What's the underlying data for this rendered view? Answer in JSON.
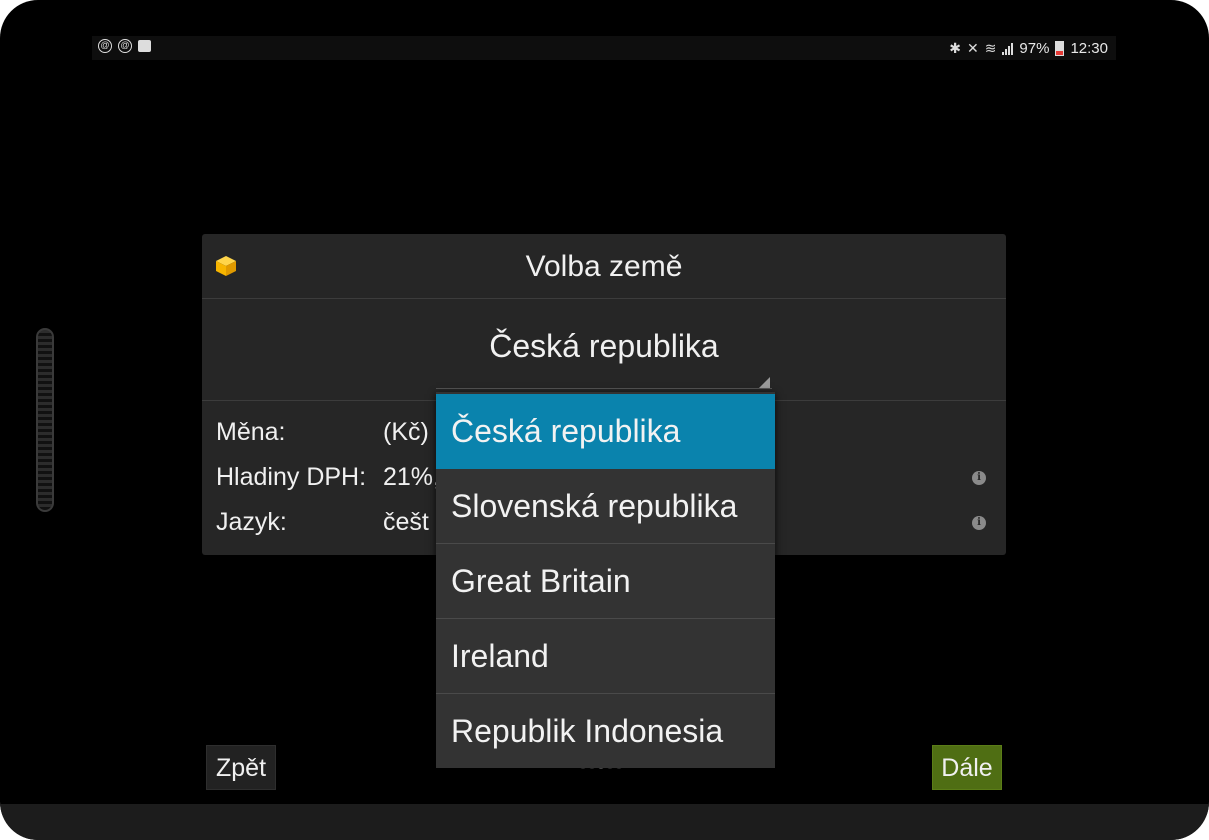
{
  "status_bar": {
    "left_icons": [
      "notification-icon",
      "notification-icon",
      "clipboard-icon"
    ],
    "battery": "97%",
    "time": "12:30",
    "icons": [
      "bluetooth-icon",
      "mute-icon",
      "wifi-icon",
      "signal-icon",
      "battery-icon"
    ]
  },
  "dialog": {
    "title": "Volba země",
    "spinner_value": "Česká republika",
    "rows": [
      {
        "label": "Měna:",
        "value": "(Kč)"
      },
      {
        "label": "Hladiny DPH:",
        "value": "21%,"
      },
      {
        "label": "Jazyk:",
        "value": "češt"
      }
    ]
  },
  "dropdown": {
    "items": [
      {
        "label": "Česká republika",
        "selected": true
      },
      {
        "label": "Slovenská republika",
        "selected": false
      },
      {
        "label": "Great Britain",
        "selected": false
      },
      {
        "label": "Ireland",
        "selected": false
      },
      {
        "label": "Republik Indonesia",
        "selected": false
      }
    ]
  },
  "buttons": {
    "back": "Zpět",
    "next": "Dále"
  },
  "colors": {
    "selected_item": "#0a83ad",
    "next_button": "#4f6e13",
    "app_icon": "#f7b500"
  }
}
